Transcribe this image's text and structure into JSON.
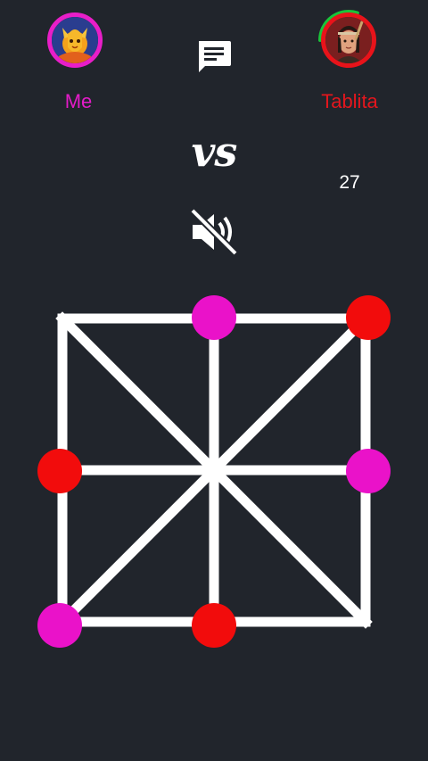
{
  "players": {
    "me": {
      "name": "Me",
      "color": "#e31bc7",
      "avatar_icon": "phoenix-avatar-icon"
    },
    "opponent": {
      "name": "Tablita",
      "color": "#e3161d",
      "avatar_icon": "warrior-avatar-icon",
      "turn_progress": 0.3
    }
  },
  "center": {
    "chat_icon": "chat-icon",
    "vs_label": "vs",
    "timer": "27",
    "sound_icon": "volume-muted-icon"
  },
  "board": {
    "line_color": "#ffffff",
    "background": "#21252c",
    "pieces": [
      {
        "pos": "top-center",
        "owner": "me",
        "color": "#ea12c9"
      },
      {
        "pos": "top-right",
        "owner": "opponent",
        "color": "#f20c0c"
      },
      {
        "pos": "middle-left",
        "owner": "opponent",
        "color": "#f20c0c"
      },
      {
        "pos": "middle-right",
        "owner": "me",
        "color": "#ea12c9"
      },
      {
        "pos": "bottom-left",
        "owner": "me",
        "color": "#ea12c9"
      },
      {
        "pos": "bottom-center",
        "owner": "opponent",
        "color": "#f20c0c"
      }
    ]
  }
}
